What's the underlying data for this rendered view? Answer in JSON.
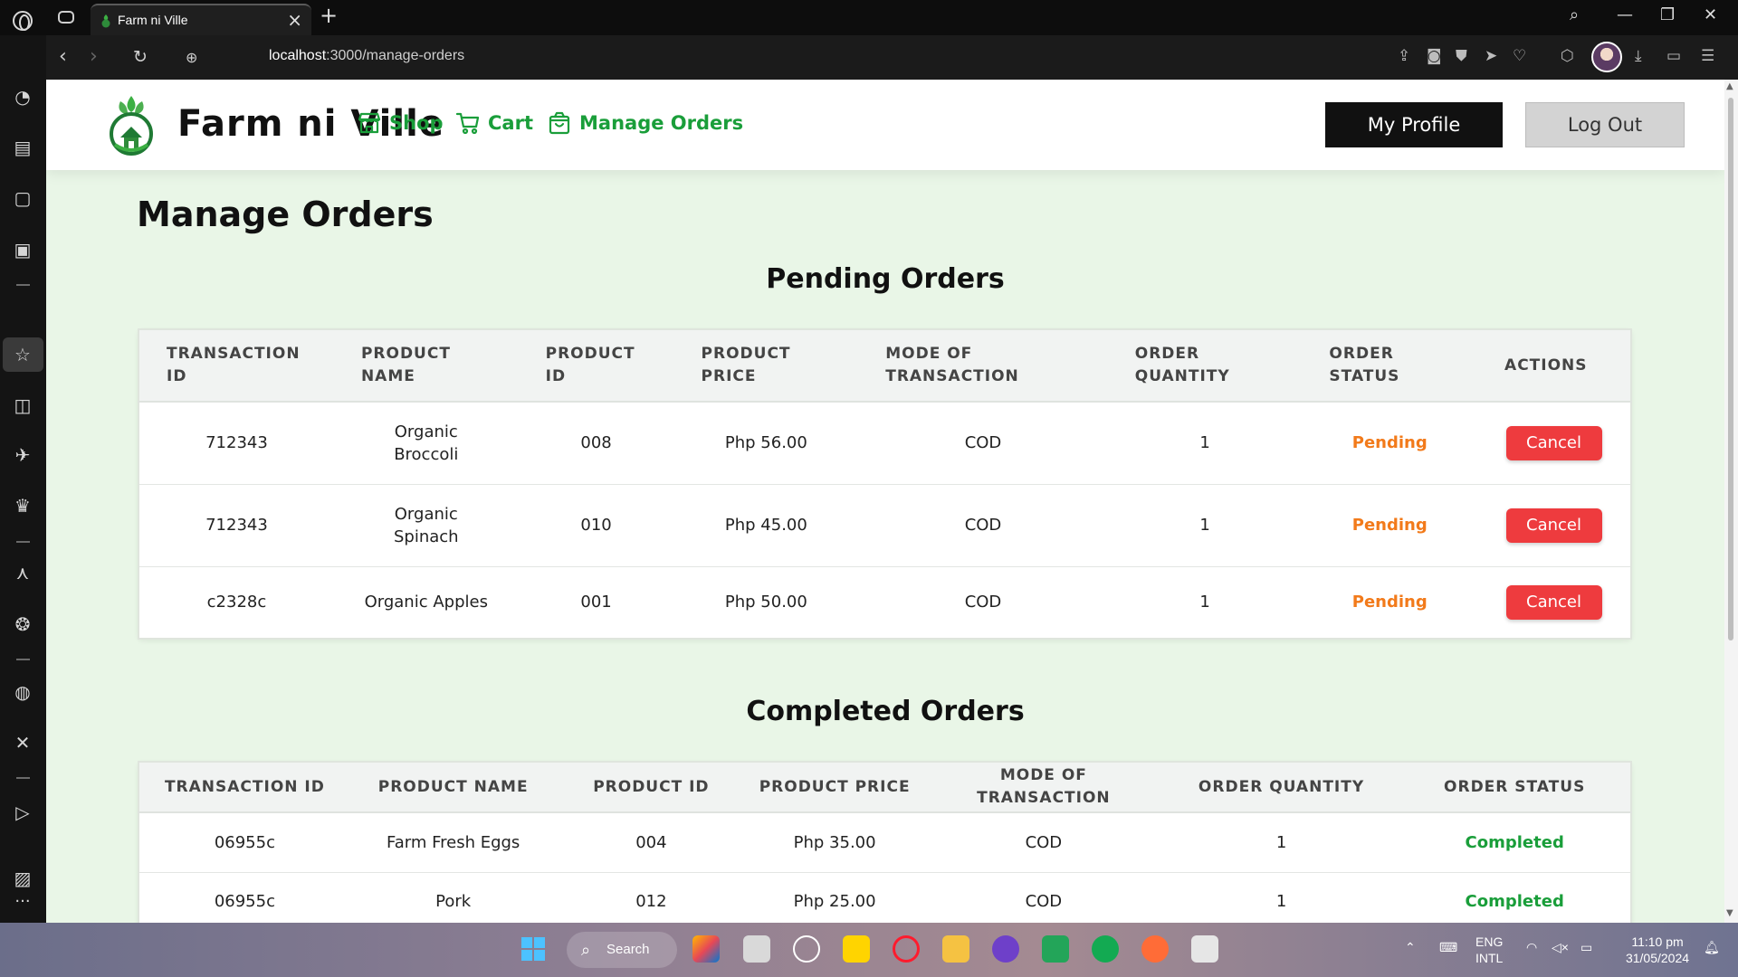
{
  "browser": {
    "tab_title": "Farm ni Ville",
    "url_host": "localhost",
    "url_rest": ":3000/manage-orders"
  },
  "site": {
    "brand": "Farm ni Ville",
    "nav": [
      {
        "label": "Shop",
        "icon": "store-icon"
      },
      {
        "label": "Cart",
        "icon": "cart-icon"
      },
      {
        "label": "Manage Orders",
        "icon": "bag-icon"
      }
    ],
    "profile_button": "My Profile",
    "logout_button": "Log Out",
    "accent_color": "#1a9e3a"
  },
  "page": {
    "title": "Manage Orders",
    "pending": {
      "title": "Pending Orders",
      "headers": [
        "TRANSACTION ID",
        "PRODUCT NAME",
        "PRODUCT ID",
        "PRODUCT PRICE",
        "MODE OF TRANSACTION",
        "ORDER QUANTITY",
        "ORDER STATUS",
        "ACTIONS"
      ],
      "rows": [
        {
          "transaction_id": "712343",
          "product_name": "Organic Broccoli",
          "product_id": "008",
          "price": "Php 56.00",
          "mode": "COD",
          "quantity": "1",
          "status": "Pending",
          "action": "Cancel"
        },
        {
          "transaction_id": "712343",
          "product_name": "Organic Spinach",
          "product_id": "010",
          "price": "Php 45.00",
          "mode": "COD",
          "quantity": "1",
          "status": "Pending",
          "action": "Cancel"
        },
        {
          "transaction_id": "c2328c",
          "product_name": "Organic Apples",
          "product_id": "001",
          "price": "Php 50.00",
          "mode": "COD",
          "quantity": "1",
          "status": "Pending",
          "action": "Cancel"
        }
      ]
    },
    "completed": {
      "title": "Completed Orders",
      "headers": [
        "TRANSACTION ID",
        "PRODUCT NAME",
        "PRODUCT ID",
        "PRODUCT PRICE",
        "MODE OF TRANSACTION",
        "ORDER QUANTITY",
        "ORDER STATUS"
      ],
      "rows": [
        {
          "transaction_id": "06955c",
          "product_name": "Farm Fresh Eggs",
          "product_id": "004",
          "price": "Php 35.00",
          "mode": "COD",
          "quantity": "1",
          "status": "Completed"
        },
        {
          "transaction_id": "06955c",
          "product_name": "Pork",
          "product_id": "012",
          "price": "Php 25.00",
          "mode": "COD",
          "quantity": "1",
          "status": "Completed"
        }
      ]
    }
  },
  "taskbar": {
    "search_label": "Search",
    "lang_line1": "ENG",
    "lang_line2": "INTL",
    "time": "11:10 pm",
    "date": "31/05/2024"
  }
}
